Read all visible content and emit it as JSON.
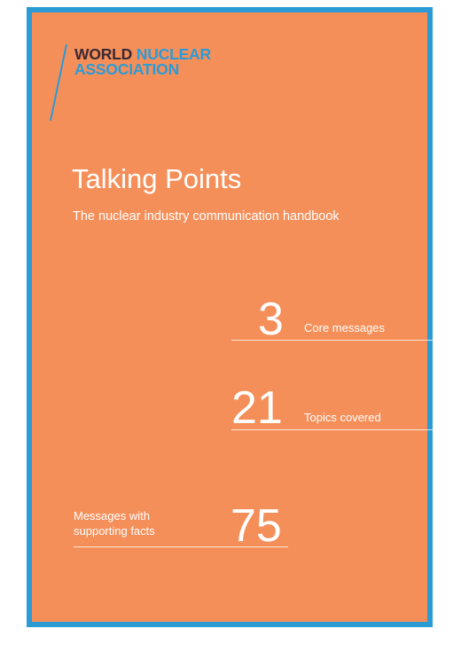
{
  "logo": {
    "line1_world": "WORLD",
    "line1_nuclear": "NUCLEAR",
    "line2": "ASSOCIATION"
  },
  "title": "Talking Points",
  "subtitle": "The nuclear industry communication handbook",
  "stats": {
    "core": {
      "number": "3",
      "label": "Core messages"
    },
    "topics": {
      "number": "21",
      "label": "Topics covered"
    },
    "messages": {
      "number": "75",
      "label_line1": "Messages with",
      "label_line2": "supporting facts"
    }
  },
  "colors": {
    "background": "#f58f5a",
    "border": "#2b9bd6",
    "logo_dark": "#3a2a33",
    "logo_blue": "#2b9bd6"
  }
}
